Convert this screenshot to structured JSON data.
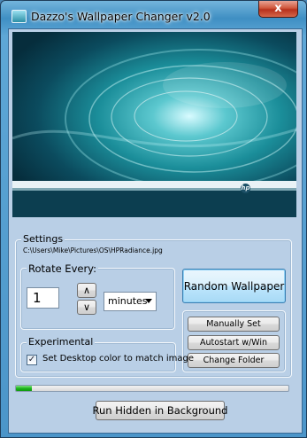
{
  "window": {
    "title": "Dazzo's Wallpaper Changer v2.0",
    "close_label": "x"
  },
  "preview": {
    "logo_text": "hp"
  },
  "settings": {
    "legend": "Settings",
    "path": "C:\\Users\\Mike\\Pictures\\OS\\HPRadiance.jpg"
  },
  "rotate": {
    "legend": "Rotate Every:",
    "value": "1",
    "up_glyph": "∧",
    "down_glyph": "∨",
    "unit": "minutes"
  },
  "buttons": {
    "random": "Random Wallpaper",
    "manual": "Manually Set",
    "autostart": "Autostart w/Win",
    "change_folder": "Change Folder",
    "run_hidden": "Run Hidden in Background"
  },
  "experimental": {
    "legend": "Experimental",
    "checkbox_label": "Set Desktop color to match image",
    "checked": true,
    "check_glyph": "✓"
  },
  "progress": {
    "percent": 6
  },
  "colors": {
    "accent": "#4b95c9",
    "progress_fill": "#1fb51f",
    "close_button": "#c8452b"
  }
}
